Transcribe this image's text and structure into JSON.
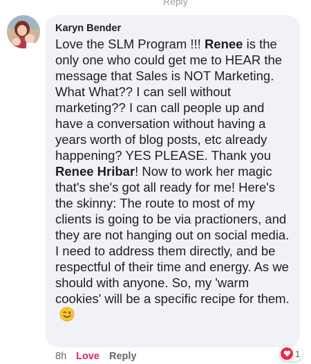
{
  "top_remnant": "Reply",
  "comment": {
    "author": "Karyn Bender",
    "segments": [
      {
        "t": "Love the SLM Program !!!  ",
        "b": false
      },
      {
        "t": "Renee",
        "b": true
      },
      {
        "t": " is the only one who could get me to HEAR the message that Sales is NOT Marketing.  What What??  I can sell without marketing??  I can call people up and have a conversation without having a years worth of blog posts, etc already happening? YES PLEASE.  Thank you ",
        "b": false
      },
      {
        "t": "Renee Hribar",
        "b": true
      },
      {
        "t": "! Now to work her magic that's she's got all ready for me!  Here's the skinny: The route to most of my clients is going to be via practioners, and they are not hanging out on social media.  I need to address them directly, and be respectful of their time and energy.  As we should with anyone.  So, my 'warm cookies' will be a specific recipe for them.",
        "b": false
      }
    ],
    "emoji_icon": "winking-face-emoji"
  },
  "actions": {
    "time": "8h",
    "love_label": "Love",
    "reply_label": "Reply"
  },
  "reaction": {
    "icon": "heart-icon",
    "count": "1",
    "color": "#f0284a"
  },
  "colors": {
    "bubble": "#f0f2f5",
    "love": "#e0245e",
    "muted": "#65676b"
  }
}
